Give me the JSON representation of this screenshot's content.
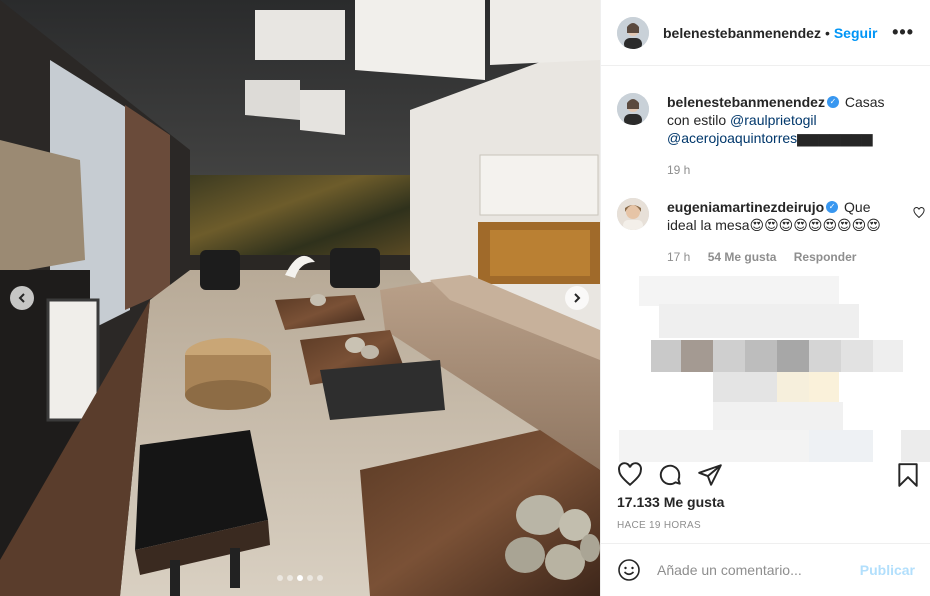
{
  "post": {
    "author": "belenestebanmenendez",
    "separator": "•",
    "follow_label": "Seguir",
    "more_label": "•••",
    "carousel": {
      "total": 5,
      "active": 2
    }
  },
  "caption": {
    "user": "belenestebanmenendez",
    "verified_mark": "✓",
    "text_before": " Casas con estilo ",
    "mention1": "@raulprietogil",
    "mention2": "@acerojoaquintorres",
    "emoji_tail": "▆▆▆▆▆▆▆",
    "time": "19 h"
  },
  "comment": {
    "user": "eugeniamartinezdeirujo",
    "verified_mark": "✓",
    "text": " Que ideal la mesa😍😍😍😍😍😍😍😍😍",
    "time": "17 h",
    "likes": "54 Me gusta",
    "reply_label": "Responder"
  },
  "stats": {
    "likes": "17.133 Me gusta",
    "posted": "HACE 19 HORAS"
  },
  "composer": {
    "placeholder": "Añade un comentario...",
    "publish_label": "Publicar"
  },
  "icons": {
    "like": "heart-icon",
    "comment": "comment-icon",
    "share": "share-icon",
    "save": "bookmark-icon",
    "emoji": "emoji-icon"
  },
  "colors": {
    "accent": "#0095f6",
    "publish_disabled": "#b2dffc",
    "verified": "#3897f0"
  }
}
